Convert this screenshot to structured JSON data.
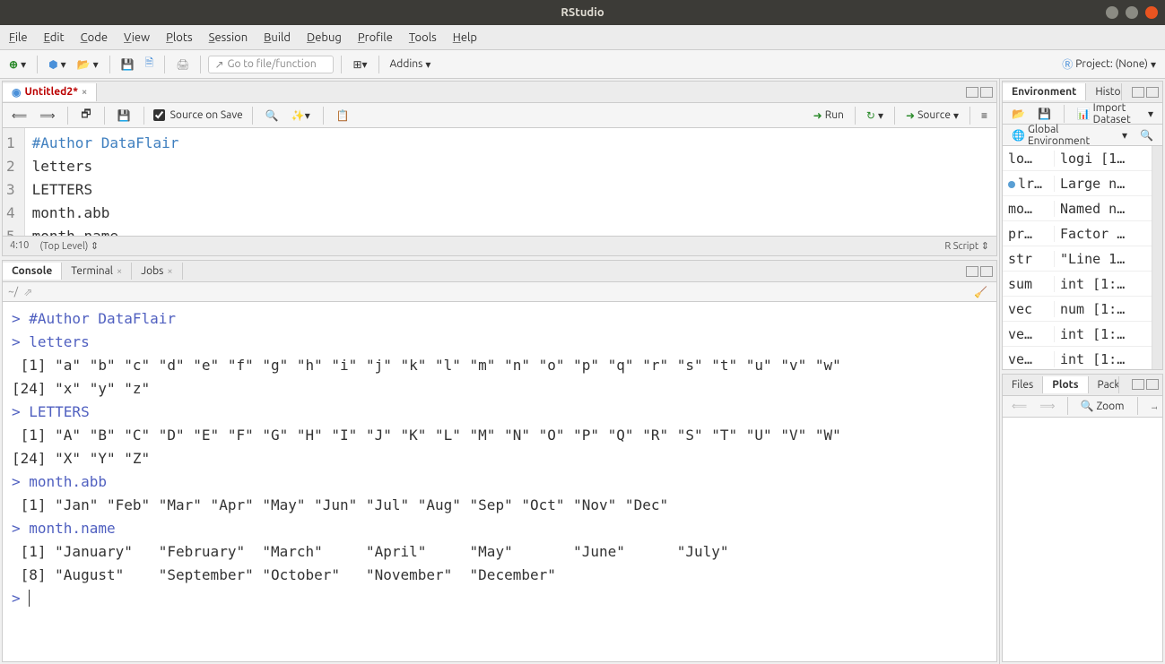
{
  "title": "RStudio",
  "menu": [
    "File",
    "Edit",
    "Code",
    "View",
    "Plots",
    "Session",
    "Build",
    "Debug",
    "Profile",
    "Tools",
    "Help"
  ],
  "project_label": "Project: (None)",
  "gotofile_placeholder": "Go to file/function",
  "addins_label": "Addins",
  "source_tab": "Untitled2*",
  "source_toolbar": {
    "source_on_save": "Source on Save",
    "run": "Run",
    "source_btn": "Source"
  },
  "editor_lines": [
    "#Author DataFlair",
    "letters",
    "LETTERS",
    "month.abb",
    "month.name"
  ],
  "cursor_pos": "4:10",
  "scope": "(Top Level)",
  "script_type": "R Script",
  "console_tabs": [
    "Console",
    "Terminal",
    "Jobs"
  ],
  "console_path": "~/",
  "console": [
    {
      "t": "cmd",
      "v": "#Author DataFlair"
    },
    {
      "t": "cmd",
      "v": "letters"
    },
    {
      "t": "out",
      "v": " [1] \"a\" \"b\" \"c\" \"d\" \"e\" \"f\" \"g\" \"h\" \"i\" \"j\" \"k\" \"l\" \"m\" \"n\" \"o\" \"p\" \"q\" \"r\" \"s\" \"t\" \"u\" \"v\" \"w\""
    },
    {
      "t": "out",
      "v": "[24] \"x\" \"y\" \"z\""
    },
    {
      "t": "cmd",
      "v": "LETTERS"
    },
    {
      "t": "out",
      "v": " [1] \"A\" \"B\" \"C\" \"D\" \"E\" \"F\" \"G\" \"H\" \"I\" \"J\" \"K\" \"L\" \"M\" \"N\" \"O\" \"P\" \"Q\" \"R\" \"S\" \"T\" \"U\" \"V\" \"W\""
    },
    {
      "t": "out",
      "v": "[24] \"X\" \"Y\" \"Z\""
    },
    {
      "t": "cmd",
      "v": "month.abb"
    },
    {
      "t": "out",
      "v": " [1] \"Jan\" \"Feb\" \"Mar\" \"Apr\" \"May\" \"Jun\" \"Jul\" \"Aug\" \"Sep\" \"Oct\" \"Nov\" \"Dec\""
    },
    {
      "t": "cmd",
      "v": "month.name"
    },
    {
      "t": "out",
      "v": " [1] \"January\"   \"February\"  \"March\"     \"April\"     \"May\"       \"June\"      \"July\"     "
    },
    {
      "t": "out",
      "v": " [8] \"August\"    \"September\" \"October\"   \"November\"  \"December\" "
    },
    {
      "t": "prompt",
      "v": ""
    }
  ],
  "env_tabs": [
    "Environment",
    "History"
  ],
  "env_toolbar": {
    "import": "Import Dataset",
    "scope": "Global Environment"
  },
  "env_rows": [
    {
      "n": "lo…",
      "v": "logi [1…"
    },
    {
      "n": "lr…",
      "v": "Large n…",
      "blue": true
    },
    {
      "n": "mo…",
      "v": "Named n…"
    },
    {
      "n": "pr…",
      "v": "Factor …"
    },
    {
      "n": "str",
      "v": "\"Line 1…"
    },
    {
      "n": "sum",
      "v": "int [1:…"
    },
    {
      "n": "vec",
      "v": "num [1:…"
    },
    {
      "n": "ve…",
      "v": "int [1:…"
    },
    {
      "n": "ve…",
      "v": "int [1:…"
    }
  ],
  "files_tabs": [
    "Files",
    "Plots",
    "Packages"
  ],
  "plots_toolbar": {
    "zoom": "Zoom",
    "export": "Export"
  }
}
